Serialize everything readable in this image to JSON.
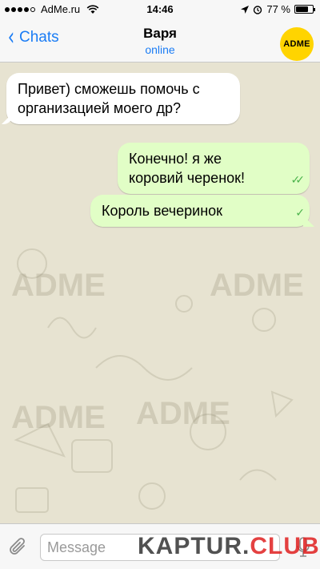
{
  "status_bar": {
    "carrier": "AdMe.ru",
    "time": "14:46",
    "battery_percent": "77 %",
    "battery_level": 0.77,
    "signal_bars_filled": 4,
    "signal_bars_total": 5
  },
  "nav": {
    "back_label": "Chats",
    "contact_name": "Варя",
    "contact_status": "online",
    "avatar_text": "ADME"
  },
  "messages": [
    {
      "direction": "in",
      "text": "Привет) сможешь помочь с организацией моего др?"
    },
    {
      "direction": "out",
      "text": "Конечно! я же коровий черенок!",
      "status": "read"
    },
    {
      "direction": "out",
      "text": "Король вечеринок",
      "status": "delivered"
    }
  ],
  "input": {
    "placeholder": "Message"
  },
  "watermark": {
    "part1": "KAPTUR.",
    "part2": "CLUB"
  },
  "colors": {
    "accent": "#1a7cf5",
    "background": "#e7e3d1",
    "out_bubble": "#e1fec6",
    "in_bubble": "#ffffff",
    "check": "#4bb34b",
    "avatar": "#ffd400"
  }
}
